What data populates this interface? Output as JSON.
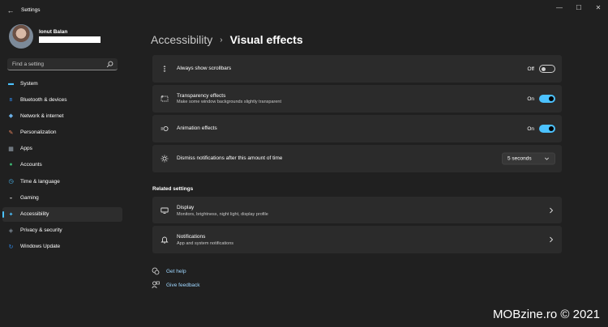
{
  "window": {
    "back_glyph": "←",
    "title": "Settings",
    "controls": {
      "minimize": "—",
      "maximize": "☐",
      "close": "✕"
    }
  },
  "profile": {
    "name": "Ionut Balan"
  },
  "search": {
    "placeholder": "Find a setting"
  },
  "sidebar": {
    "items": [
      {
        "label": "System",
        "icon": "system-icon",
        "color": "#4cc2ff",
        "glyph": "▬"
      },
      {
        "label": "Bluetooth & devices",
        "icon": "bluetooth-icon",
        "color": "#2f88e8",
        "glyph": "ʙ"
      },
      {
        "label": "Network & internet",
        "icon": "network-icon",
        "color": "#6bb1e8",
        "glyph": "◆"
      },
      {
        "label": "Personalization",
        "icon": "brush-icon",
        "color": "#e4815c",
        "glyph": "✎"
      },
      {
        "label": "Apps",
        "icon": "apps-icon",
        "color": "#9aa6b2",
        "glyph": "▦"
      },
      {
        "label": "Accounts",
        "icon": "accounts-icon",
        "color": "#3cb371",
        "glyph": "●"
      },
      {
        "label": "Time & language",
        "icon": "clock-icon",
        "color": "#4cc2ff",
        "glyph": "◷"
      },
      {
        "label": "Gaming",
        "icon": "gamepad-icon",
        "color": "#a0a0a0",
        "glyph": "◒"
      },
      {
        "label": "Accessibility",
        "icon": "accessibility-icon",
        "color": "#4cc2ff",
        "glyph": "✦",
        "active": true
      },
      {
        "label": "Privacy & security",
        "icon": "shield-icon",
        "color": "#7d8a96",
        "glyph": "◈"
      },
      {
        "label": "Windows Update",
        "icon": "update-icon",
        "color": "#2f88e8",
        "glyph": "↻"
      }
    ]
  },
  "breadcrumb": {
    "parent": "Accessibility",
    "separator": "›",
    "current": "Visual effects"
  },
  "settings": {
    "scrollbars": {
      "title": "Always show scrollbars",
      "state": "Off"
    },
    "transparency": {
      "title": "Transparency effects",
      "description": "Make some window backgrounds slightly transparent",
      "state": "On"
    },
    "animation": {
      "title": "Animation effects",
      "state": "On"
    },
    "notifications_timeout": {
      "title": "Dismiss notifications after this amount of time",
      "value": "5 seconds"
    }
  },
  "related": {
    "heading": "Related settings",
    "display": {
      "title": "Display",
      "description": "Monitors, brightness, night light, display profile"
    },
    "notifications": {
      "title": "Notifications",
      "description": "App and system notifications"
    }
  },
  "links": {
    "help": "Get help",
    "feedback": "Give feedback"
  },
  "watermark": "MOBzine.ro © 2021",
  "colors": {
    "accent": "#4cc2ff",
    "background": "#202020",
    "card": "#2b2b2b",
    "link": "#9fd7ff"
  }
}
